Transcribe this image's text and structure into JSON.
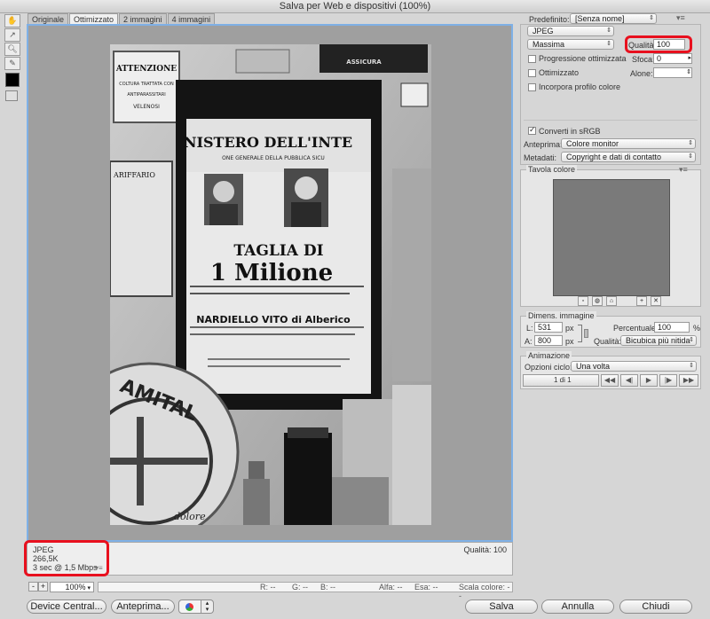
{
  "window": {
    "title": "Salva per Web e dispositivi (100%)"
  },
  "tabs": [
    {
      "label": "Originale"
    },
    {
      "label": "Ottimizzato"
    },
    {
      "label": "2 immagini"
    },
    {
      "label": "4 immagini"
    }
  ],
  "preview": {
    "photo_text": {
      "attenzione": "ATTENZIONE",
      "coltura": "COLTURA TRATTATA CON",
      "anti": "ANTIPARASSITARI",
      "veleno": "VELENOSI",
      "ministero": "NISTERO DELL'INTE",
      "direzione": "ONE GENERALE DELLA PUBBLICA SICU",
      "taglia": "TAGLIA DI",
      "milione": "1 Milione",
      "nardiello": "NARDIELLO VITO di Alberico",
      "tariffario": "ARIFFARIO",
      "amital": "AMITAL",
      "dolore": "dolore",
      "assicur": "ASSICURA"
    }
  },
  "status": {
    "format": "JPEG",
    "size": "266,5K",
    "time": "3 sec @ 1,5 Mbps",
    "quality": "Qualità: 100"
  },
  "zoom": {
    "minus": "-",
    "plus": "+",
    "value": "100%"
  },
  "infobar": {
    "r": "R: --",
    "g": "G: --",
    "b": "B: --",
    "alfa": "Alfa: --",
    "esa": "Esa: --",
    "scala": "Scala colore: --"
  },
  "buttons": {
    "device_central": "Device Central...",
    "anteprima": "Anteprima...",
    "salva": "Salva",
    "annulla": "Annulla",
    "chiudi": "Chiudi"
  },
  "settings": {
    "predefinito_label": "Predefinito:",
    "predefinito_value": "[Senza nome]",
    "format_value": "JPEG",
    "quality_preset": "Massima",
    "qualita_label": "Qualità:",
    "qualita_value": "100",
    "progressiva_label": "Progressione ottimizzata",
    "sfoca_label": "Sfoca:",
    "sfoca_value": "0",
    "ottimizzato_label": "Ottimizzato",
    "alone_label": "Alone:",
    "incorpora_label": "Incorpora profilo colore",
    "converti_label": "Converti in sRGB",
    "anteprima_label": "Anteprima:",
    "anteprima_value": "Colore monitor",
    "metadati_label": "Metadati:",
    "metadati_value": "Copyright e dati di contatto"
  },
  "color_table": {
    "title": "Tavola colore"
  },
  "image_size": {
    "title": "Dimens. immagine",
    "l_label": "L:",
    "l_value": "531",
    "a_label": "A:",
    "a_value": "800",
    "px": "px",
    "percent_label": "Percentuale:",
    "percent_value": "100",
    "percent_unit": "%",
    "quality_label": "Qualità:",
    "quality_value": "Bicubica più nitida"
  },
  "animation": {
    "title": "Animazione",
    "loop_label": "Opzioni ciclo:",
    "loop_value": "Una volta",
    "frame": "1 di 1"
  }
}
